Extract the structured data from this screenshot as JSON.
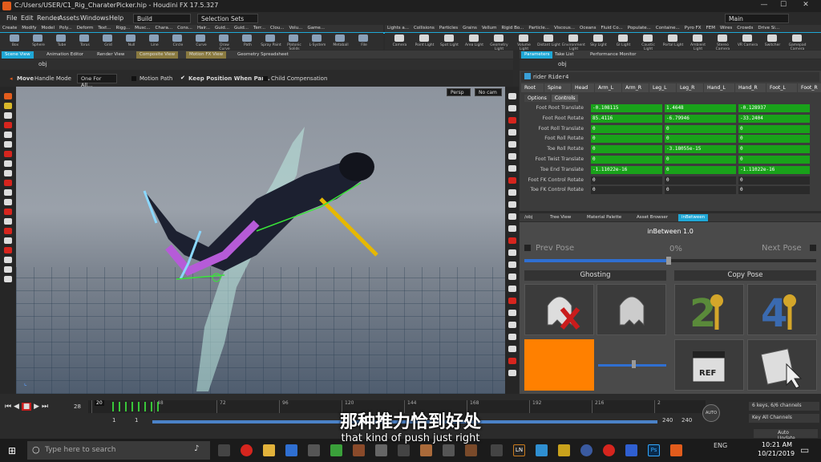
{
  "window": {
    "title": "C:/Users/USER/C1_Rig_CharaterPicker.hip - Houdini FX 17.5.327",
    "minimize": "—",
    "maximize": "☐",
    "close": "✕"
  },
  "menu": {
    "items": [
      "File",
      "Edit",
      "Render",
      "Assets",
      "Windows",
      "Help"
    ],
    "desktop": "Build",
    "selection_sets": "Selection Sets",
    "main": "Main"
  },
  "shelf": {
    "tabs_left": [
      "Create",
      "Modify",
      "Model",
      "Poly...",
      "Deform",
      "Text...",
      "Rigg...",
      "Musc...",
      "Chara...",
      "Cons...",
      "Hair...",
      "Guid...",
      "Guid...",
      "Terr...",
      "Clou...",
      "Volu...",
      "Game..."
    ],
    "tabs_right": [
      "Lights a...",
      "Collisions",
      "Particles",
      "Grains",
      "Vellum",
      "Rigid Bo...",
      "Particle...",
      "Viscous...",
      "Oceans",
      "Fluid Co...",
      "Populate...",
      "Containe...",
      "Pyro FX",
      "FEM",
      "Wires",
      "Crowds",
      "Drive Si..."
    ],
    "tools_left": [
      "Box",
      "Sphere",
      "Tube",
      "Torus",
      "Grid",
      "Null",
      "Line",
      "Circle",
      "Curve",
      "Draw Curve",
      "Path",
      "Spray Paint",
      "Platonic Solids",
      "L-System",
      "Metaball",
      "File"
    ],
    "tools_right": [
      "Camera",
      "Point Light",
      "Spot Light",
      "Area Light",
      "Geometry Light",
      "Volume Light",
      "Distant Light",
      "Environment Light",
      "Sky Light",
      "GI Light",
      "Caustic Light",
      "Portal Light",
      "Ambient Light",
      "Stereo Camera",
      "VR Camera",
      "Switcher",
      "Gamepad Camera"
    ]
  },
  "pane_tabs_left": [
    "Scene View",
    "Animation Editor",
    "Render View",
    "Composite View",
    "Motion FX View",
    "Geometry Spreadsheet"
  ],
  "pane_tabs_right": [
    "Parameters",
    "Take List",
    "Performance Monitor"
  ],
  "path_left": "obj",
  "path_right": "obj",
  "viewport_toolbar": {
    "move": "Move",
    "handle_mode": "Handle Mode",
    "one_for_all": "One For All...",
    "motion_path": "Motion Path",
    "keep_position": "Keep Position When Par...",
    "child_comp": "Child Compensation",
    "persp": "Persp",
    "no_cam": "No cam"
  },
  "params": {
    "node_type": "rider",
    "node_name": "Rider4",
    "group_tabs": [
      "Root",
      "Spine",
      "Head",
      "Arm_L",
      "Arm_R",
      "Leg_L",
      "Leg_R",
      "Hand_L",
      "Hand_R",
      "Foot_L",
      "Foot_R"
    ],
    "sub_tabs": [
      "Options",
      "Controls"
    ],
    "rows": [
      {
        "label": "Foot Root Translate",
        "v": [
          "-0.108115",
          "1.4648",
          "-0.128937"
        ],
        "green": true
      },
      {
        "label": "Foot Root Rotate",
        "v": [
          "85.4116",
          "-6.79946",
          "-33.2404"
        ],
        "green": true
      },
      {
        "label": "Foot Roll Translate",
        "v": [
          "0",
          "0",
          "0"
        ],
        "green": true
      },
      {
        "label": "Foot Roll Rotate",
        "v": [
          "0",
          "0",
          "0"
        ],
        "green": true
      },
      {
        "label": "Toe Roll Rotate",
        "v": [
          "0",
          "-3.18055e-15",
          "0"
        ],
        "green": true
      },
      {
        "label": "Foot Twist Translate",
        "v": [
          "0",
          "0",
          "0"
        ],
        "green": true
      },
      {
        "label": "Toe End Translate",
        "v": [
          "-1.11022e-16",
          "0",
          "-1.11022e-16"
        ],
        "green": true
      },
      {
        "label": "Foot FK Control Rotate",
        "v": [
          "0",
          "0",
          "0"
        ],
        "green": false
      },
      {
        "label": "Toe FK Control Rotate",
        "v": [
          "0",
          "0",
          "0"
        ],
        "green": false
      }
    ]
  },
  "lower_tabs": [
    "/obj",
    "Tree View",
    "Material Palette",
    "Asset Browser",
    "inBetween"
  ],
  "inbetween": {
    "title": "inBetween 1.0",
    "prev": "Prev Pose",
    "next": "Next Pose",
    "pct": "0%",
    "slider": 0.5,
    "ghosting": "Ghosting",
    "copy_pose": "Copy Pose",
    "ref": "REF",
    "orange": "#ff8000"
  },
  "timeline": {
    "frame": "28",
    "ticks": [
      "20",
      "48",
      "72",
      "96",
      "120",
      "144",
      "168",
      "192",
      "216",
      "2"
    ],
    "start": "1",
    "start2": "1",
    "end": "240",
    "end2": "240",
    "current": "20",
    "keys": "6 keys, 6/6 channels",
    "key_all": "Key All Channels",
    "auto_update": "Auto Update",
    "auto": "AUTO"
  },
  "subtitle": {
    "cn": "那种推力恰到好处",
    "en": "that kind of push just right"
  },
  "taskbar": {
    "search": "Type here to search",
    "time": "10:21 AM",
    "date": "10/21/2019",
    "lang": "ENG",
    "ln": "LN",
    "ps": "Ps"
  },
  "colors": {
    "accent": "#1fa7d6",
    "green": "#19a21a",
    "houdini": "#e25c1c"
  }
}
